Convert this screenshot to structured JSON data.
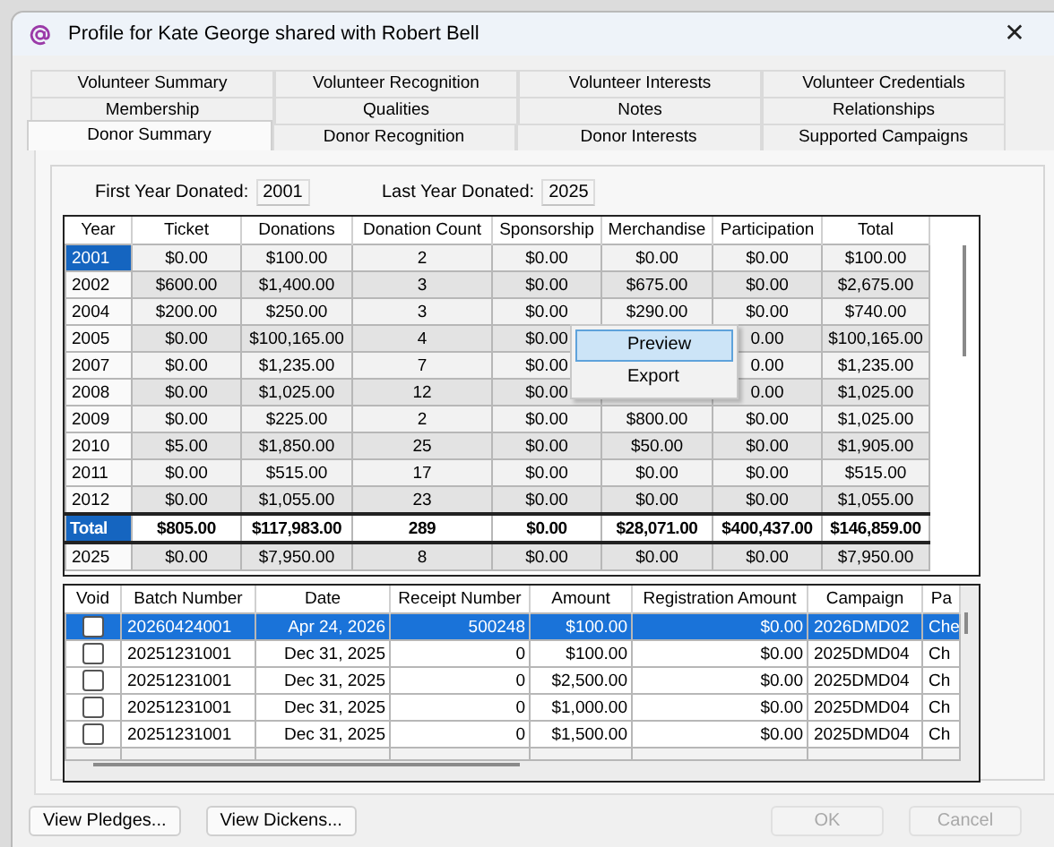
{
  "window": {
    "title": "Profile for Kate George shared with Robert Bell",
    "close": "✕"
  },
  "tab_rows": [
    [
      {
        "label": "Volunteer Summary",
        "selected": false
      },
      {
        "label": "Volunteer Recognition",
        "selected": false
      },
      {
        "label": "Volunteer Interests",
        "selected": false
      },
      {
        "label": "Volunteer Credentials",
        "selected": false
      }
    ],
    [
      {
        "label": "Membership",
        "selected": false
      },
      {
        "label": "Qualities",
        "selected": false
      },
      {
        "label": "Notes",
        "selected": false
      },
      {
        "label": "Relationships",
        "selected": false
      }
    ],
    [
      {
        "label": "Donor Summary",
        "selected": true
      },
      {
        "label": "Donor Recognition",
        "selected": false
      },
      {
        "label": "Donor Interests",
        "selected": false
      },
      {
        "label": "Supported Campaigns",
        "selected": false
      }
    ]
  ],
  "year_fields": [
    {
      "label": "First Year Donated:",
      "value": "2001"
    },
    {
      "label": "Last Year Donated:",
      "value": "2025"
    }
  ],
  "summary_table": {
    "columns": [
      "Year",
      "Ticket",
      "Donations",
      "Donation Count",
      "Sponsorship",
      "Merchandise",
      "Participation",
      "Total"
    ],
    "rows": [
      {
        "kind": "year",
        "selected": true,
        "cells": [
          "2001",
          "$0.00",
          "$100.00",
          "2",
          "$0.00",
          "$0.00",
          "$0.00",
          "$100.00"
        ]
      },
      {
        "kind": "year",
        "selected": false,
        "cells": [
          "2002",
          "$600.00",
          "$1,400.00",
          "3",
          "$0.00",
          "$675.00",
          "$0.00",
          "$2,675.00"
        ]
      },
      {
        "kind": "year",
        "selected": false,
        "cells": [
          "2004",
          "$200.00",
          "$250.00",
          "3",
          "$0.00",
          "$290.00",
          "$0.00",
          "$740.00"
        ]
      },
      {
        "kind": "year",
        "selected": false,
        "cells": [
          "2005",
          "$0.00",
          "$100,165.00",
          "4",
          "$0.00",
          null,
          "0.00",
          "$100,165.00"
        ]
      },
      {
        "kind": "year",
        "selected": false,
        "cells": [
          "2007",
          "$0.00",
          "$1,235.00",
          "7",
          "$0.00",
          null,
          "0.00",
          "$1,235.00"
        ]
      },
      {
        "kind": "year",
        "selected": false,
        "cells": [
          "2008",
          "$0.00",
          "$1,025.00",
          "12",
          "$0.00",
          null,
          "0.00",
          "$1,025.00"
        ]
      },
      {
        "kind": "year",
        "selected": false,
        "cells": [
          "2009",
          "$0.00",
          "$225.00",
          "2",
          "$0.00",
          "$800.00",
          "$0.00",
          "$1,025.00"
        ]
      },
      {
        "kind": "year",
        "selected": false,
        "cells": [
          "2010",
          "$5.00",
          "$1,850.00",
          "25",
          "$0.00",
          "$50.00",
          "$0.00",
          "$1,905.00"
        ]
      },
      {
        "kind": "year",
        "selected": false,
        "cells": [
          "2011",
          "$0.00",
          "$515.00",
          "17",
          "$0.00",
          "$0.00",
          "$0.00",
          "$515.00"
        ]
      },
      {
        "kind": "year",
        "selected": false,
        "cells": [
          "2012",
          "$0.00",
          "$1,055.00",
          "23",
          "$0.00",
          "$0.00",
          "$0.00",
          "$1,055.00"
        ]
      },
      {
        "kind": "total",
        "cells": [
          "Total",
          "$805.00",
          "$117,983.00",
          "289",
          "$0.00",
          "$28,071.00",
          "$400,437.00",
          "$146,859.00"
        ]
      },
      {
        "kind": "year",
        "selected": false,
        "cells": [
          "2025",
          "$0.00",
          "$7,950.00",
          "8",
          "$0.00",
          "$0.00",
          "$0.00",
          "$7,950.00"
        ]
      }
    ]
  },
  "context_menu": [
    {
      "label": "Preview",
      "selected": true
    },
    {
      "label": "Export",
      "selected": false
    }
  ],
  "transactions_table": {
    "columns": [
      "Void",
      "Batch Number",
      "Date",
      "Receipt Number",
      "Amount",
      "Registration Amount",
      "Campaign",
      "Pa"
    ],
    "rows": [
      {
        "void": false,
        "selected": true,
        "cells": [
          "",
          "20260424001",
          "Apr 24, 2026",
          "500248",
          "$100.00",
          "$0.00",
          "2026DMD02",
          "Che"
        ]
      },
      {
        "void": false,
        "selected": false,
        "cells": [
          "",
          "20251231001",
          "Dec 31, 2025",
          "0",
          "$100.00",
          "$0.00",
          "2025DMD04",
          "Ch"
        ]
      },
      {
        "void": false,
        "selected": false,
        "cells": [
          "",
          "20251231001",
          "Dec 31, 2025",
          "0",
          "$2,500.00",
          "$0.00",
          "2025DMD04",
          "Ch"
        ]
      },
      {
        "void": false,
        "selected": false,
        "cells": [
          "",
          "20251231001",
          "Dec 31, 2025",
          "0",
          "$1,000.00",
          "$0.00",
          "2025DMD04",
          "Ch"
        ]
      },
      {
        "void": false,
        "selected": false,
        "cells": [
          "",
          "20251231001",
          "Dec 31, 2025",
          "0",
          "$1,500.00",
          "$0.00",
          "2025DMD04",
          "Ch"
        ]
      }
    ]
  },
  "buttons": [
    {
      "label": "View Pledges...",
      "disabled": false
    },
    {
      "label": "View Dickens...",
      "disabled": false
    },
    {
      "label": "OK",
      "disabled": true
    },
    {
      "label": "Cancel",
      "disabled": true
    }
  ]
}
